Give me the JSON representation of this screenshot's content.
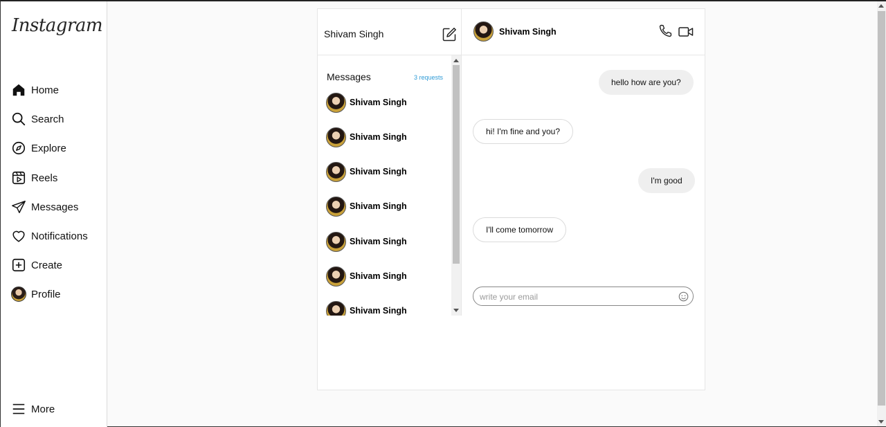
{
  "app": {
    "logo": "Instagram"
  },
  "sidebar": {
    "items": [
      {
        "label": "Home",
        "icon": "home-icon"
      },
      {
        "label": "Search",
        "icon": "search-icon"
      },
      {
        "label": "Explore",
        "icon": "compass-icon"
      },
      {
        "label": "Reels",
        "icon": "reels-icon"
      },
      {
        "label": "Messages",
        "icon": "send-icon"
      },
      {
        "label": "Notifications",
        "icon": "heart-icon"
      },
      {
        "label": "Create",
        "icon": "plus-square-icon"
      },
      {
        "label": "Profile",
        "icon": "avatar"
      }
    ],
    "more": {
      "label": "More",
      "icon": "menu-icon"
    }
  },
  "inbox": {
    "username": "Shivam Singh",
    "title": "Messages",
    "requests": "3 requests",
    "conversations": [
      {
        "name": "Shivam Singh"
      },
      {
        "name": "Shivam Singh"
      },
      {
        "name": "Shivam Singh"
      },
      {
        "name": "Shivam Singh"
      },
      {
        "name": "Shivam Singh"
      },
      {
        "name": "Shivam Singh"
      },
      {
        "name": "Shivam Singh"
      }
    ]
  },
  "chat": {
    "contact": "Shivam Singh",
    "messages": [
      {
        "text": "hello how are you?",
        "direction": "outgoing"
      },
      {
        "text": "hi! I'm fine and you?",
        "direction": "incoming"
      },
      {
        "text": "I'm good",
        "direction": "outgoing"
      },
      {
        "text": "I'll come tomorrow",
        "direction": "incoming"
      }
    ],
    "composer": {
      "placeholder": "write your email",
      "value": ""
    }
  },
  "colors": {
    "accent_link": "#2f9bd6",
    "outgoing_bubble": "#efefef",
    "border": "#dbdbdb"
  }
}
